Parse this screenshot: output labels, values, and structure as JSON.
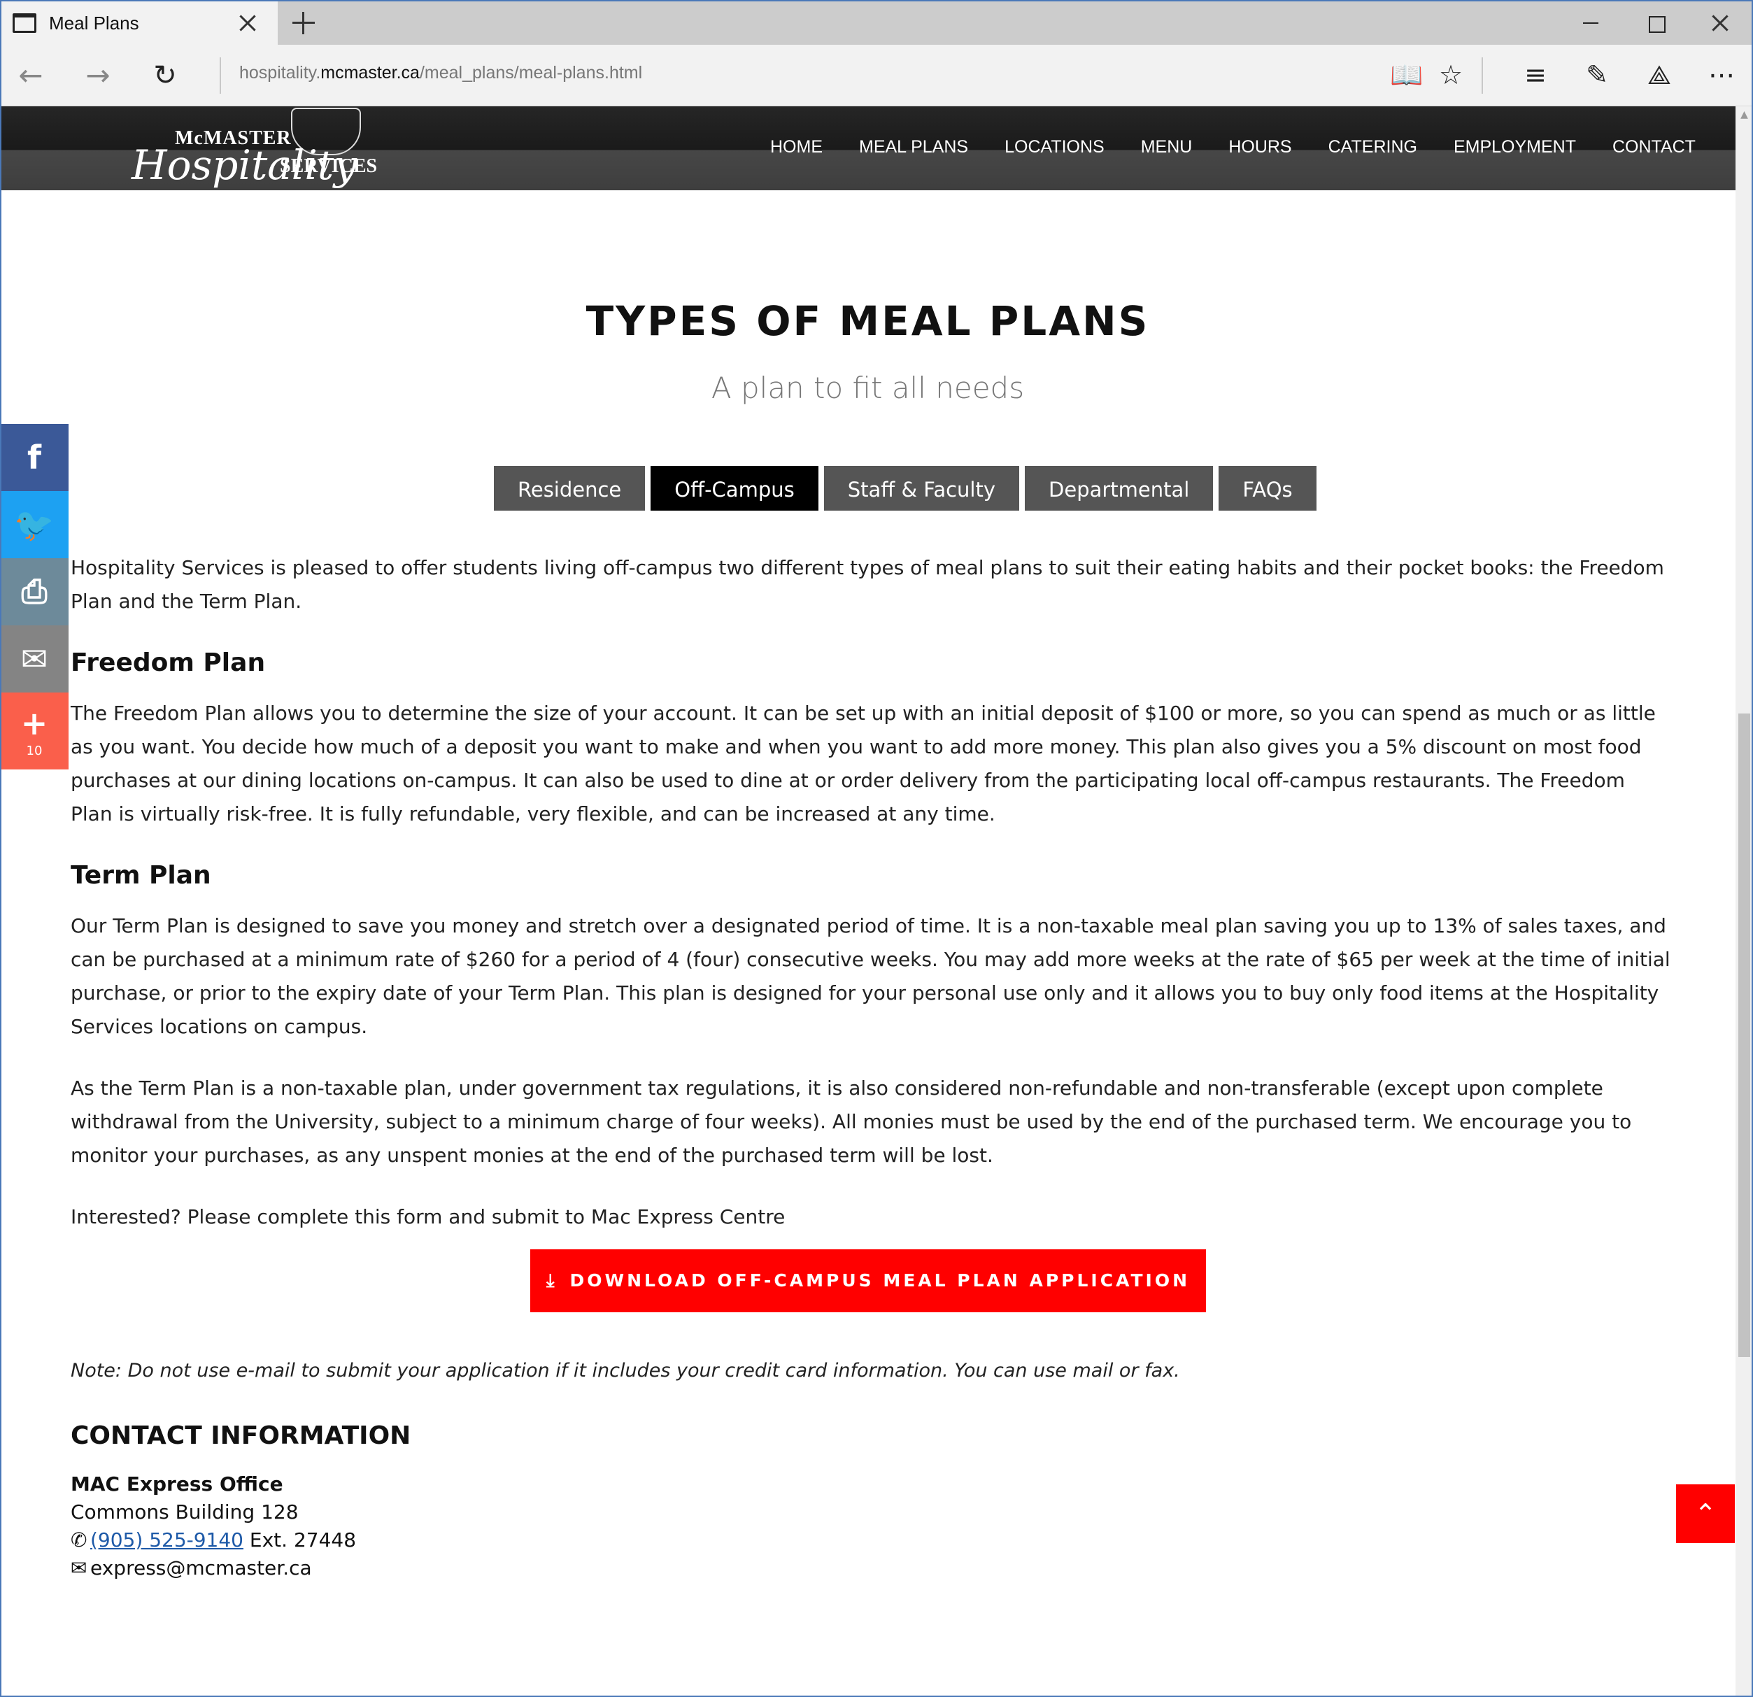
{
  "browser": {
    "tab_title": "Meal Plans",
    "url_prefix": "hospitality.",
    "url_host": "mcmaster.ca",
    "url_path": "/meal_plans/meal-plans.html"
  },
  "logo": {
    "mcmaster": "McMASTER",
    "hospitality": "Hospitality",
    "services": "SERVICES"
  },
  "nav": [
    "HOME",
    "MEAL PLANS",
    "LOCATIONS",
    "MENU",
    "HOURS",
    "CATERING",
    "EMPLOYMENT",
    "CONTACT"
  ],
  "page": {
    "title": "TYPES OF MEAL PLANS",
    "subtitle": "A plan to fit all needs"
  },
  "tabs": [
    {
      "label": "Residence",
      "active": false
    },
    {
      "label": "Off-Campus",
      "active": true
    },
    {
      "label": "Staff & Faculty",
      "active": false
    },
    {
      "label": "Departmental",
      "active": false
    },
    {
      "label": "FAQs",
      "active": false
    }
  ],
  "content": {
    "intro": "Hospitality Services is pleased to offer students living off-campus two different types of meal plans to suit their eating habits and their pocket books: the Freedom Plan and the Term Plan.",
    "freedom_heading": "Freedom Plan",
    "freedom_text": "The Freedom Plan allows you to determine the size of your account. It can be set up with an initial deposit of $100 or more, so you can spend as much or as little as you want. You decide how much of a deposit you want to make and when you want to add more money. This plan also gives you a 5% discount on most food purchases at our dining locations on-campus. It can also be used to dine at or order delivery from the participating local off-campus restaurants. The Freedom Plan is virtually risk-free. It is fully refundable, very flexible, and can be increased at any time.",
    "term_heading": "Term Plan",
    "term_text_1": "Our Term Plan is designed to save you money and stretch over a designated period of time. It is a non-taxable meal plan saving you up to 13% of sales taxes, and can be purchased at a minimum rate of $260 for a period of 4 (four) consecutive weeks. You may add more weeks at the rate of $65 per week at the time of initial purchase, or prior to the expiry date of your Term Plan. This plan is designed for your personal use only and it allows you to buy only food items at the Hospitality Services locations on campus.",
    "term_text_2": "As the Term Plan is a non-taxable plan, under government tax regulations, it is also considered non-refundable and non-transferable (except upon complete withdrawal from the University, subject to a minimum charge of four weeks). All monies must be used by the end of the purchased term. We encourage you to monitor your purchases, as any unspent monies at the end of the purchased term will be lost.",
    "interested": "Interested? Please complete this form and submit to Mac Express Centre",
    "download_label": "DOWNLOAD OFF-CAMPUS MEAL PLAN APPLICATION",
    "note": "Note: Do not use e-mail to submit your application if it includes your credit card information. You can use mail or fax."
  },
  "contact": {
    "heading": "CONTACT INFORMATION",
    "office": "MAC Express Office",
    "building": "Commons Building 128",
    "phone": "(905) 525-9140",
    "ext": " Ext. 27448",
    "email": "express@mcmaster.ca"
  },
  "share": {
    "count": "10"
  },
  "colors": {
    "accent_red": "#ff0000",
    "tab_gray": "#555555",
    "tab_active": "#000000",
    "facebook": "#3b5998",
    "twitter": "#1da1f2"
  }
}
